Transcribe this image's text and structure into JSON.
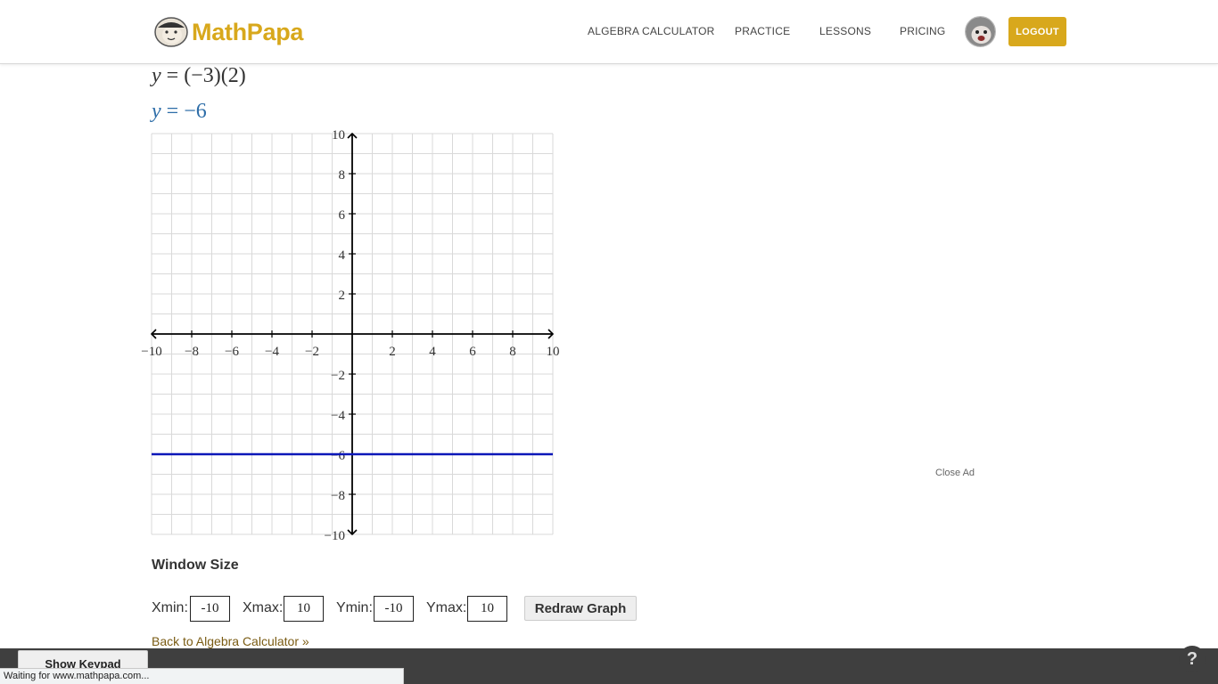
{
  "header": {
    "brand_name": "MathPapa",
    "nav": [
      {
        "label": "ALGEBRA CALCULATOR"
      },
      {
        "label": "PRACTICE"
      },
      {
        "label": "LESSONS"
      },
      {
        "label": "PRICING"
      }
    ],
    "logout_label": "LOGOUT"
  },
  "equations": {
    "line1_var": "y",
    "line1_rest": " = (−3)(2)",
    "line2_var": "y",
    "line2_rest": " = −6"
  },
  "chart_data": {
    "type": "line",
    "series": [
      {
        "x": [
          -10,
          10
        ],
        "y": [
          -6,
          -6
        ]
      }
    ],
    "xlim": [
      -10,
      10
    ],
    "ylim": [
      -10,
      10
    ],
    "xticks": [
      "−10",
      "−8",
      "−6",
      "−4",
      "−2",
      "2",
      "4",
      "6",
      "8",
      "10"
    ],
    "yticks": [
      "10",
      "8",
      "6",
      "4",
      "2",
      "−2",
      "−4",
      "−6",
      "−8",
      "−10"
    ],
    "grid": true,
    "colors": {
      "line": "#0c17b8",
      "grid": "#d9d9d9",
      "axis": "#000000"
    }
  },
  "window_size": {
    "title": "Window Size",
    "xmin_label": "Xmin:",
    "xmin_value": "-10",
    "xmax_label": "Xmax:",
    "xmax_value": "10",
    "ymin_label": "Ymin:",
    "ymin_value": "-10",
    "ymax_label": "Ymax:",
    "ymax_value": "10",
    "redraw_label": "Redraw Graph"
  },
  "back_link": "Back to Algebra Calculator »",
  "close_ad": "Close Ad",
  "keypad_label": "Show Keypad",
  "help_label": "?",
  "status_text": "Waiting for www.mathpapa.com..."
}
